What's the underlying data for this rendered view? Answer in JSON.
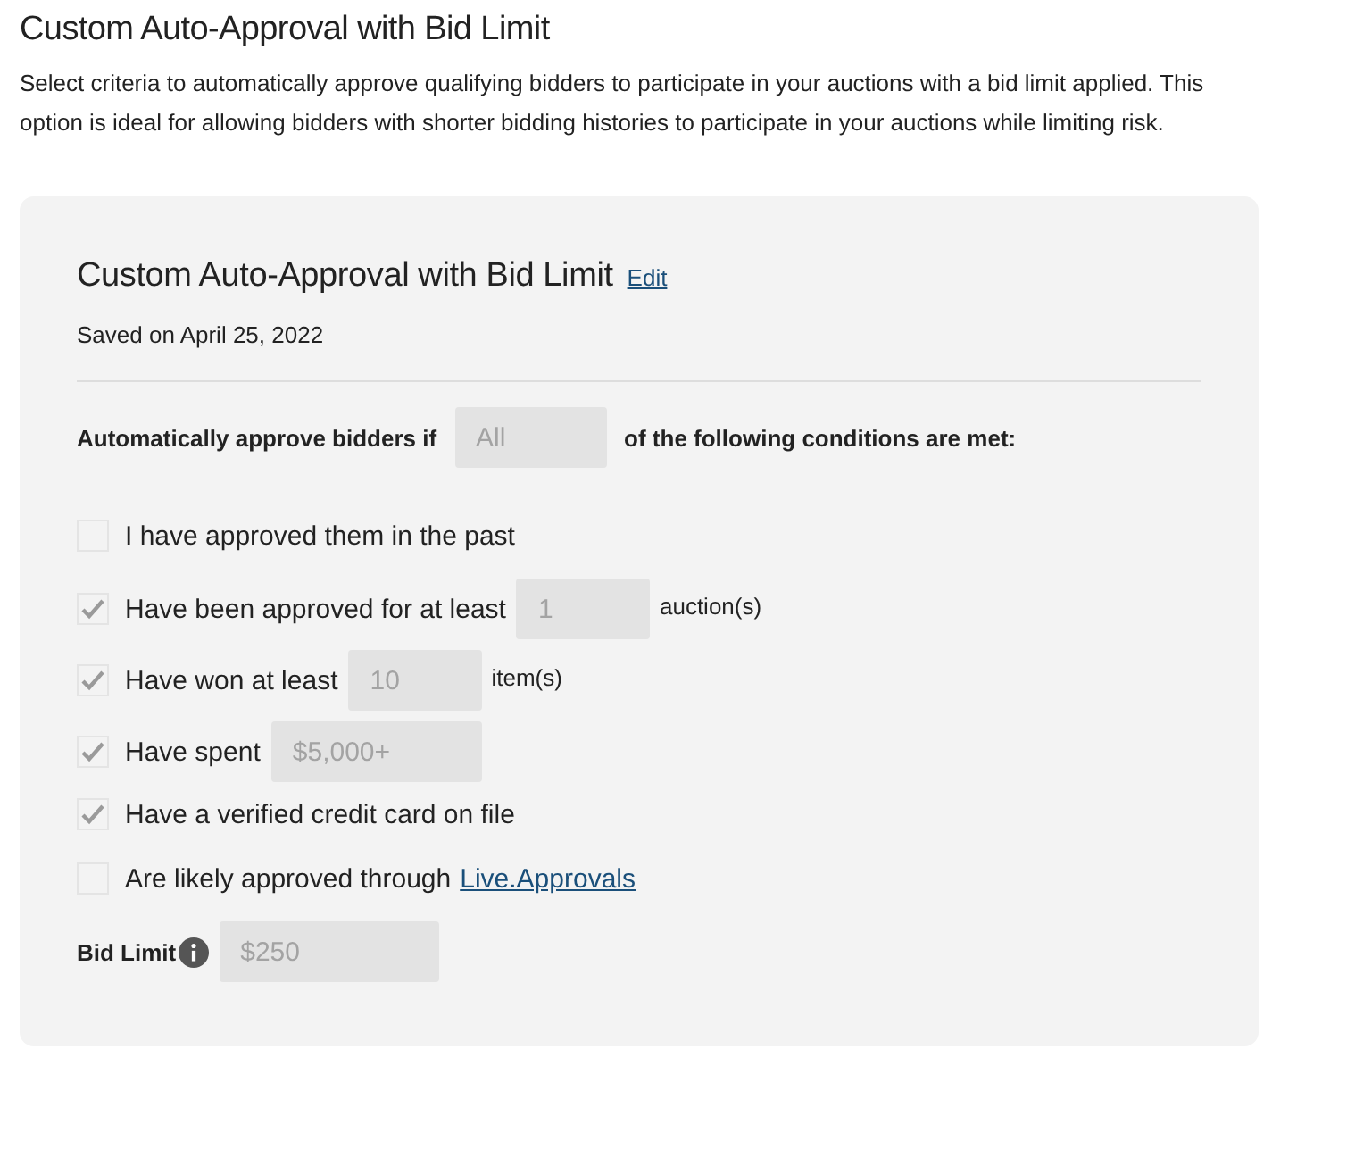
{
  "page_title": "Custom Auto-Approval with Bid Limit",
  "description": "Select criteria to automatically approve qualifying bidders to participate in your auctions with a bid limit applied. This option is ideal for allowing bidders with shorter bidding histories to participate in your auctions while limiting risk.",
  "card": {
    "title": "Custom Auto-Approval with Bid Limit",
    "edit_link": "Edit",
    "saved": "Saved on April 25, 2022",
    "rule": {
      "prefix": "Automatically approve bidders if",
      "value": "All",
      "suffix": "of the following conditions are met:"
    },
    "conditions": [
      {
        "label": "I have approved them in the past",
        "checked": false
      },
      {
        "label": "Have been approved for at least",
        "checked": true,
        "value": "1",
        "suffix": "auction(s)"
      },
      {
        "label": "Have won at least",
        "checked": true,
        "value": "10",
        "suffix": "item(s)"
      },
      {
        "label": "Have spent",
        "checked": true,
        "value": "$5,000+"
      },
      {
        "label": "Have a verified credit card on file",
        "checked": true
      },
      {
        "label": "Are likely approved through",
        "checked": false,
        "link": "Live.Approvals"
      }
    ],
    "bid_limit": {
      "label": "Bid Limit",
      "value": "$250"
    }
  }
}
